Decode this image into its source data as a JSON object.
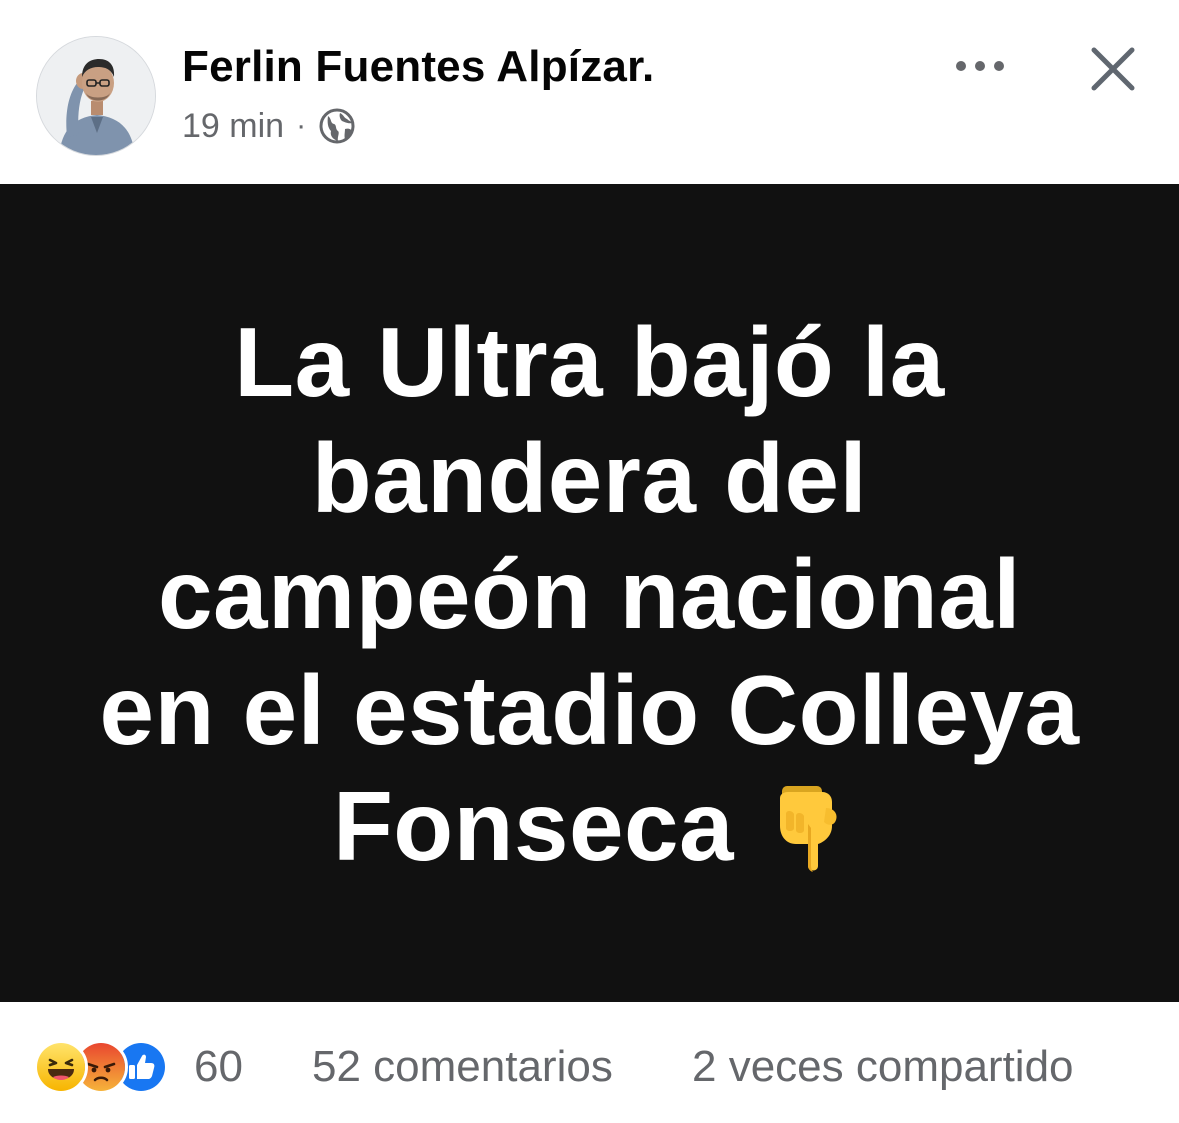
{
  "post": {
    "author": "Ferlin Fuentes Alpízar.",
    "time": "19 min",
    "separator": "·",
    "audience_icon": "globe-icon",
    "header_actions": {
      "more_icon": "more-dots-icon",
      "close_icon": "close-icon"
    },
    "image_text_lines": [
      "La Ultra bajó la",
      "bandera del",
      "campeón nacional",
      "en el estadio Colleya",
      "Fonseca"
    ],
    "image_emoji": "pointing-down-hand-emoji",
    "colors": {
      "image_background": "#111111",
      "image_text": "#ffffff",
      "secondary_text": "#65676b",
      "like_blue": "#1877f2"
    }
  },
  "footer": {
    "reaction_icons": [
      "haha-reaction-icon",
      "angry-reaction-icon",
      "like-reaction-icon"
    ],
    "reaction_count": "60",
    "comments": "52 comentarios",
    "shares": "2 veces compartido"
  }
}
